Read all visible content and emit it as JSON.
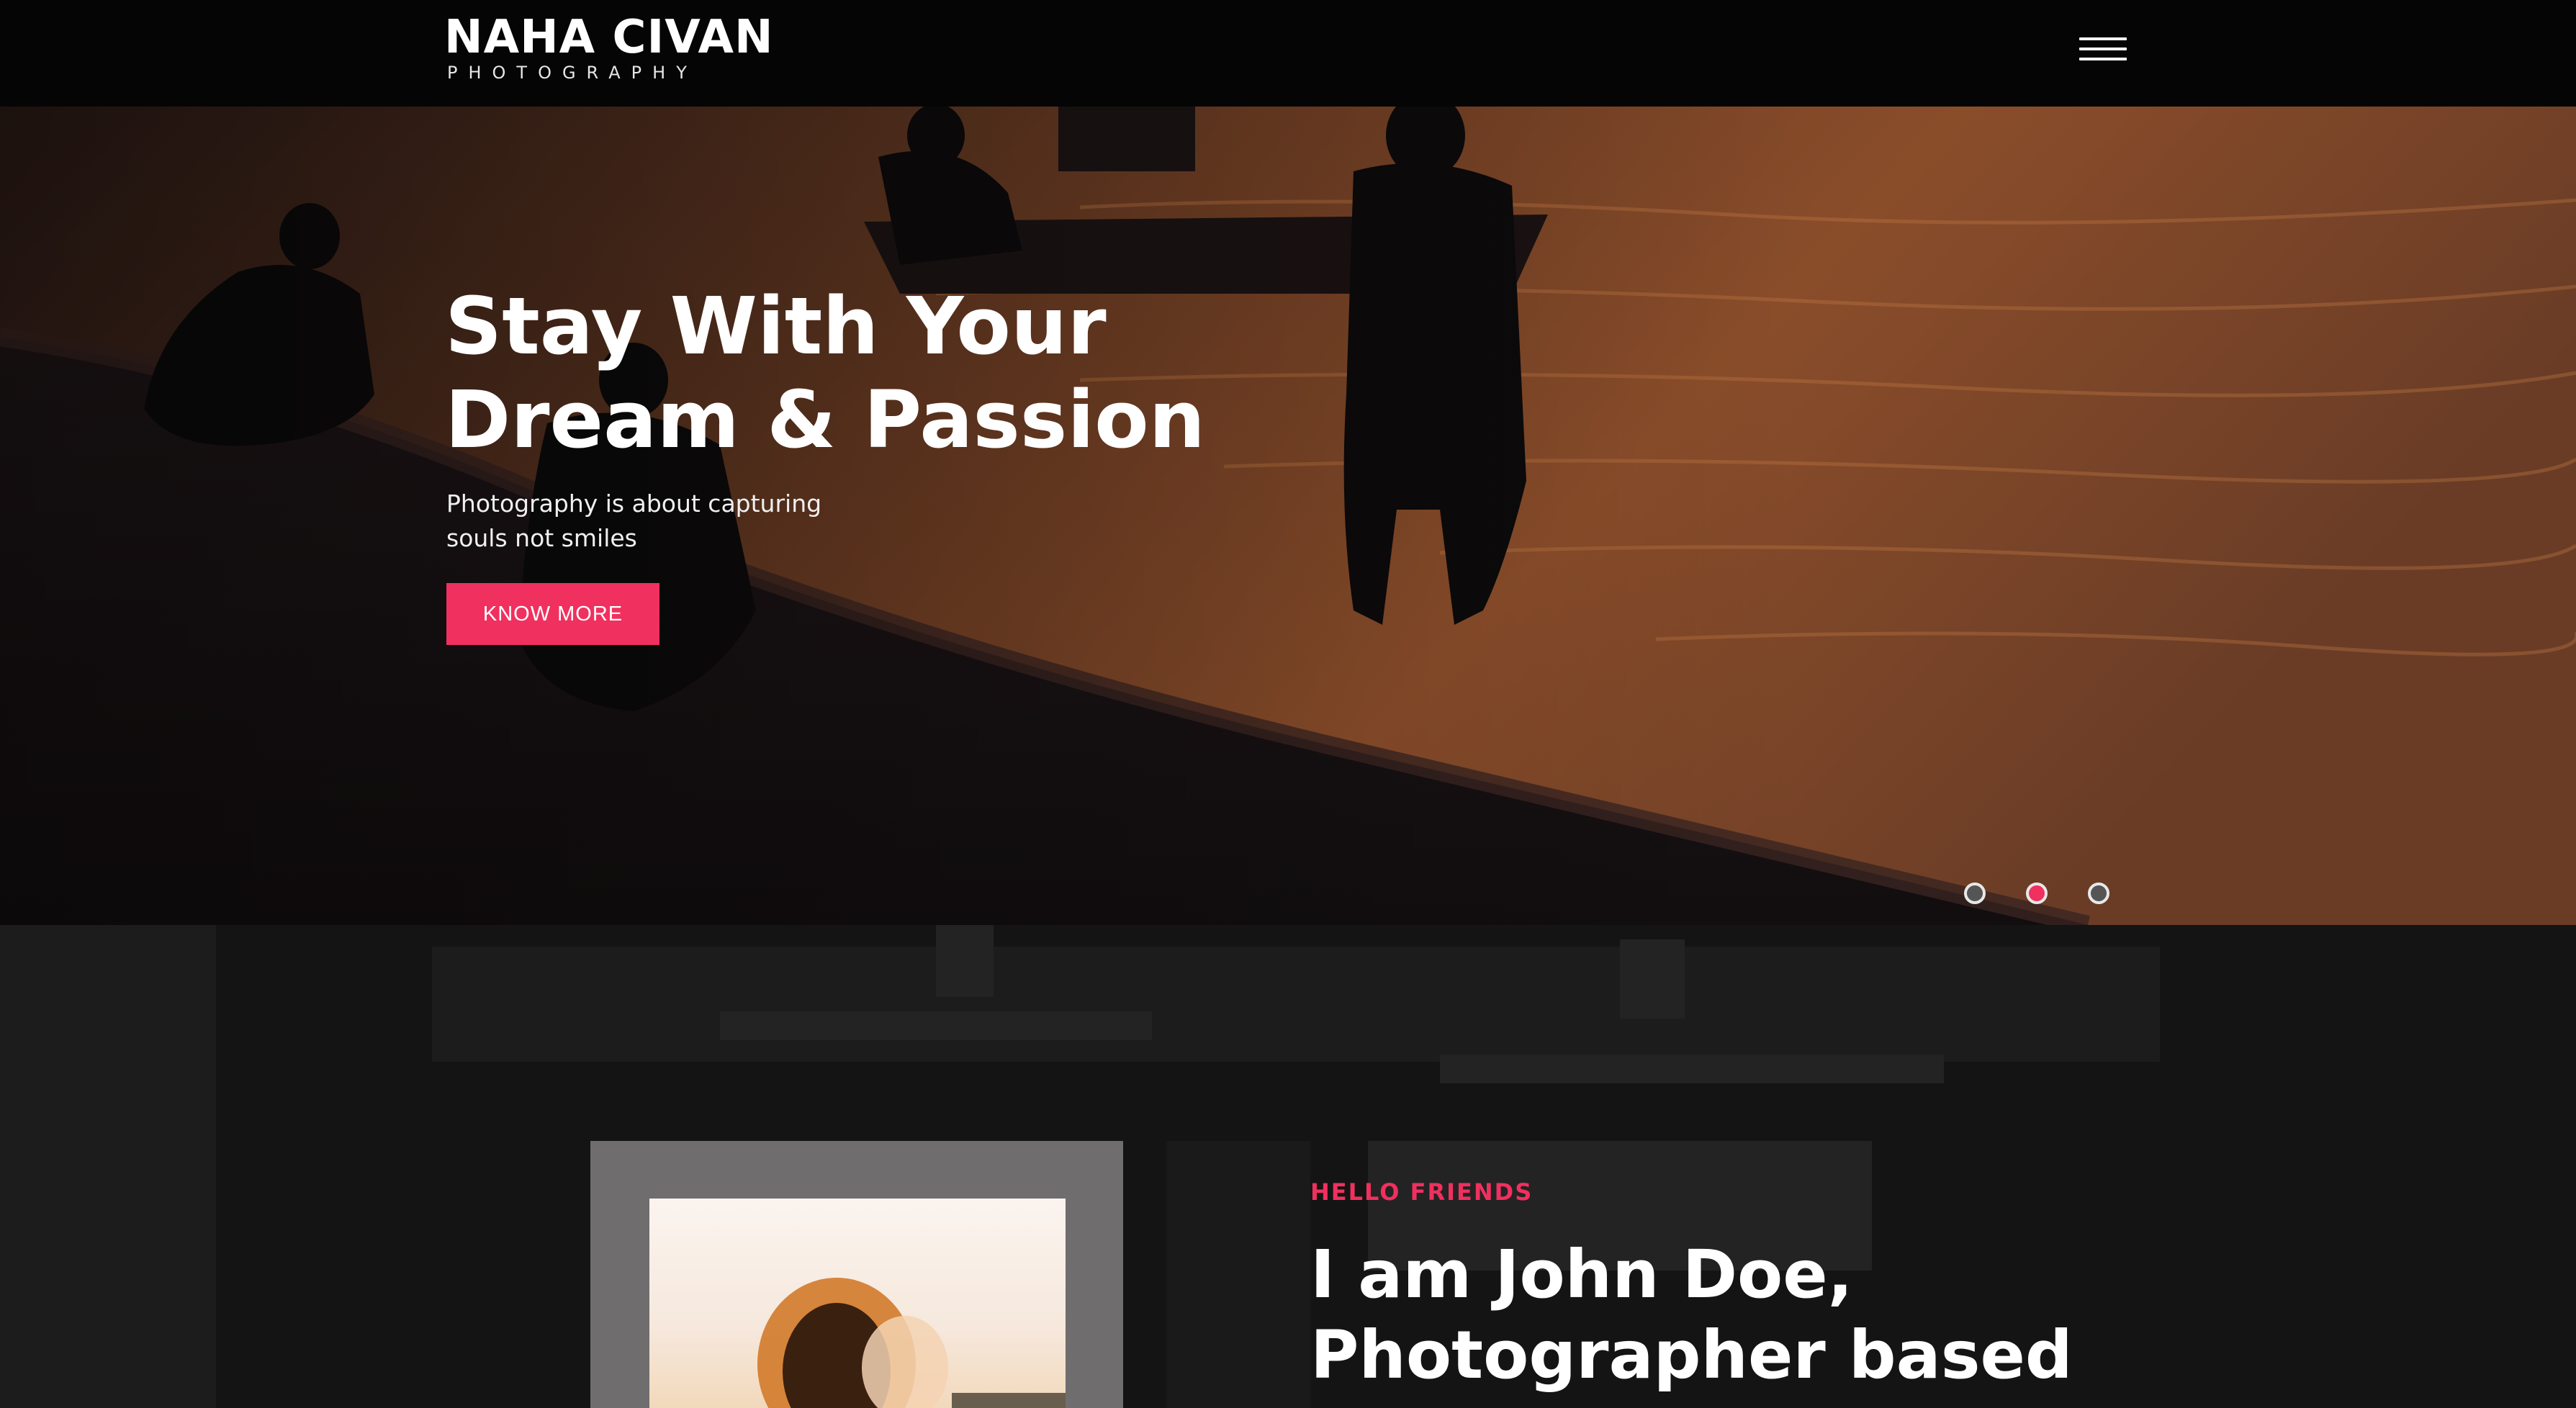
{
  "header": {
    "logo_name": "NAHA CIVAN",
    "logo_tagline": "PHOTOGRAPHY",
    "menu_icon": "hamburger-menu-icon"
  },
  "hero": {
    "title_line1": "Stay With Your",
    "title_line2": "Dream & Passion",
    "subtitle_line1": "Photography is about capturing",
    "subtitle_line2": "souls not smiles",
    "cta_label": "KNOW MORE",
    "slides_total": 3,
    "active_slide": 2
  },
  "about": {
    "kicker": "HELLO FRIENDS",
    "title_line1": "I am John Doe,",
    "title_line2": "Photographer based"
  },
  "colors": {
    "accent": "#f0305f",
    "header_bg": "#050505",
    "section_bg": "#141414",
    "text": "#ffffff"
  }
}
